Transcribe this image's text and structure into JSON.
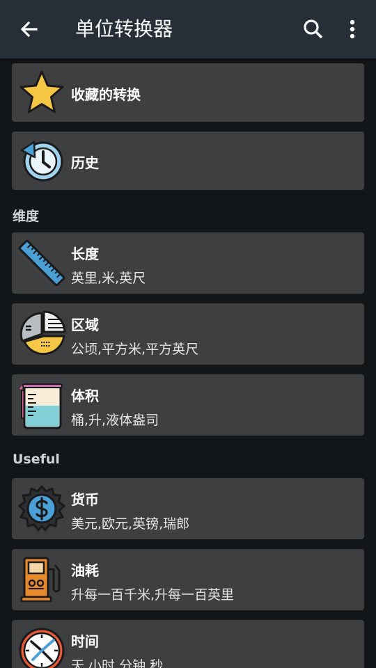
{
  "appbar": {
    "title": "单位转换器",
    "back_icon": "arrow-left-icon",
    "search_icon": "search-icon",
    "more_icon": "more-vert-icon"
  },
  "quick": {
    "favorites_label": "收藏的转换",
    "history_label": "历史"
  },
  "sections": {
    "dimensions": "维度",
    "useful": "Useful"
  },
  "items": {
    "length": {
      "label": "长度",
      "units": "英里,米,英尺",
      "icon": "ruler-icon"
    },
    "area": {
      "label": "区域",
      "units": "公顷,平方米,平方英尺",
      "icon": "area-chart-icon"
    },
    "volume": {
      "label": "体积",
      "units": "桶,升,液体盎司",
      "icon": "measuring-cup-icon"
    },
    "currency": {
      "label": "货币",
      "units": "美元,欧元,英镑,瑞郎",
      "icon": "dollar-gear-icon"
    },
    "fuel": {
      "label": "油耗",
      "units": "升每一百千米,升每一百英里",
      "icon": "fuel-pump-icon"
    },
    "time": {
      "label": "时间",
      "units": "天,小时,分钟,秒",
      "icon": "clock-icon"
    }
  },
  "colors": {
    "appbar": "#262f37",
    "background": "#121619",
    "card": "#3e3f41",
    "star": "#f6c744"
  }
}
